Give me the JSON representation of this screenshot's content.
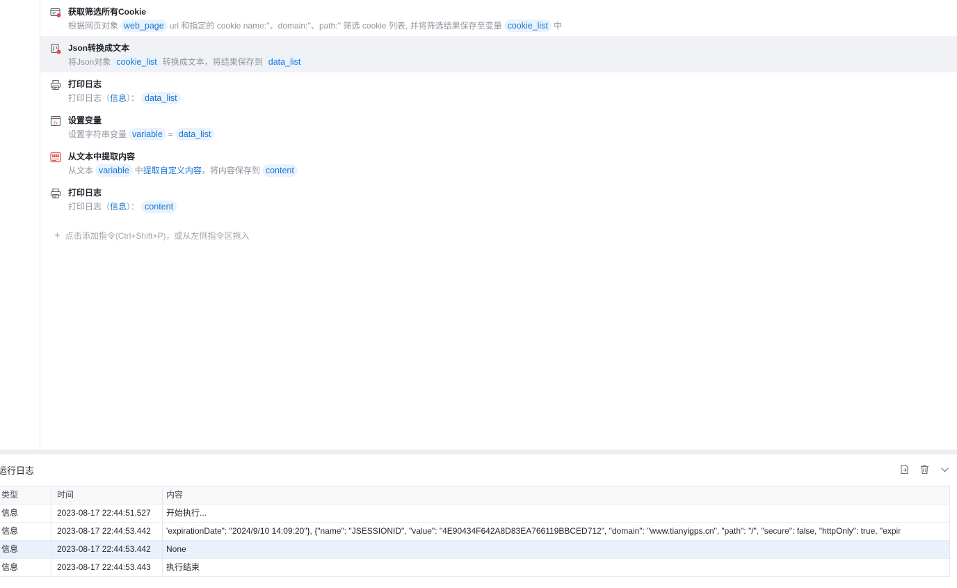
{
  "steps": [
    {
      "icon": "cookie-filter-icon",
      "title": "获取筛选所有Cookie",
      "parts": [
        {
          "t": "text",
          "v": "根据网页对象"
        },
        {
          "t": "chip",
          "v": "web_page"
        },
        {
          "t": "text",
          "v": "url 和指定的 cookie name:''、domain:''、path:'' 筛选 cookie 列表, 并将筛选结果保存至变量"
        },
        {
          "t": "chip",
          "v": "cookie_list"
        },
        {
          "t": "text",
          "v": "中"
        }
      ]
    },
    {
      "icon": "json-convert-icon",
      "title": "Json转换成文本",
      "parts": [
        {
          "t": "text",
          "v": "将Json对象"
        },
        {
          "t": "chip",
          "v": "cookie_list"
        },
        {
          "t": "text",
          "v": "转换成文本，将结果保存到"
        },
        {
          "t": "chip",
          "v": "data_list"
        }
      ]
    },
    {
      "icon": "print-log-icon",
      "title": "打印日志",
      "parts": [
        {
          "t": "text",
          "v": "打印日志（"
        },
        {
          "t": "link",
          "v": "信息"
        },
        {
          "t": "text",
          "v": "）："
        },
        {
          "t": "chip",
          "v": "data_list"
        }
      ]
    },
    {
      "icon": "set-variable-icon",
      "title": "设置变量",
      "parts": [
        {
          "t": "text",
          "v": "设置字符串变量"
        },
        {
          "t": "chip",
          "v": "variable"
        },
        {
          "t": "text",
          "v": "="
        },
        {
          "t": "chip",
          "v": "data_list"
        }
      ]
    },
    {
      "icon": "extract-text-icon",
      "title": "从文本中提取内容",
      "parts": [
        {
          "t": "text",
          "v": "从文本"
        },
        {
          "t": "chip",
          "v": "variable"
        },
        {
          "t": "text",
          "v": "中"
        },
        {
          "t": "link",
          "v": "提取自定义内容"
        },
        {
          "t": "text",
          "v": "，将内容保存到"
        },
        {
          "t": "chip",
          "v": "content"
        }
      ]
    },
    {
      "icon": "print-log-icon",
      "title": "打印日志",
      "parts": [
        {
          "t": "text",
          "v": "打印日志（"
        },
        {
          "t": "link",
          "v": "信息"
        },
        {
          "t": "text",
          "v": "）："
        },
        {
          "t": "chip",
          "v": "content"
        }
      ]
    }
  ],
  "selected_step": 1,
  "add_hint": "点击添加指令(Ctrl+Shift+P)，或从左侧指令区拖入",
  "log": {
    "title": "运行日志",
    "tools": [
      "export-log-icon",
      "delete-log-icon",
      "collapse-chevron-icon"
    ],
    "columns": [
      "类型",
      "时间",
      "内容"
    ],
    "rows": [
      {
        "type": "信息",
        "time": "2023-08-17 22:44:51.527",
        "content": "开始执行..."
      },
      {
        "type": "信息",
        "time": "2023-08-17 22:44:53.442",
        "content": "'expirationDate\": \"2024/9/10 14:09:20\"}, {\"name\": \"JSESSIONID\", \"value\": \"4E90434F642A8D83EA766119BBCED712\", \"domain\": \"www.tianyigps.cn\", \"path\": \"/\", \"secure\": false, \"httpOnly\": true, \"expir"
      },
      {
        "type": "信息",
        "time": "2023-08-17 22:44:53.442",
        "content": "None"
      },
      {
        "type": "信息",
        "time": "2023-08-17 22:44:53.443",
        "content": "执行结束"
      }
    ],
    "highlight_row": 2
  },
  "colors": {
    "chip_bg": "#e9f3fe",
    "chip_text": "#1976d2",
    "selected_row": "#f0f2f5",
    "log_highlight": "#e8f1fc",
    "icon_red": "#e5484d"
  }
}
